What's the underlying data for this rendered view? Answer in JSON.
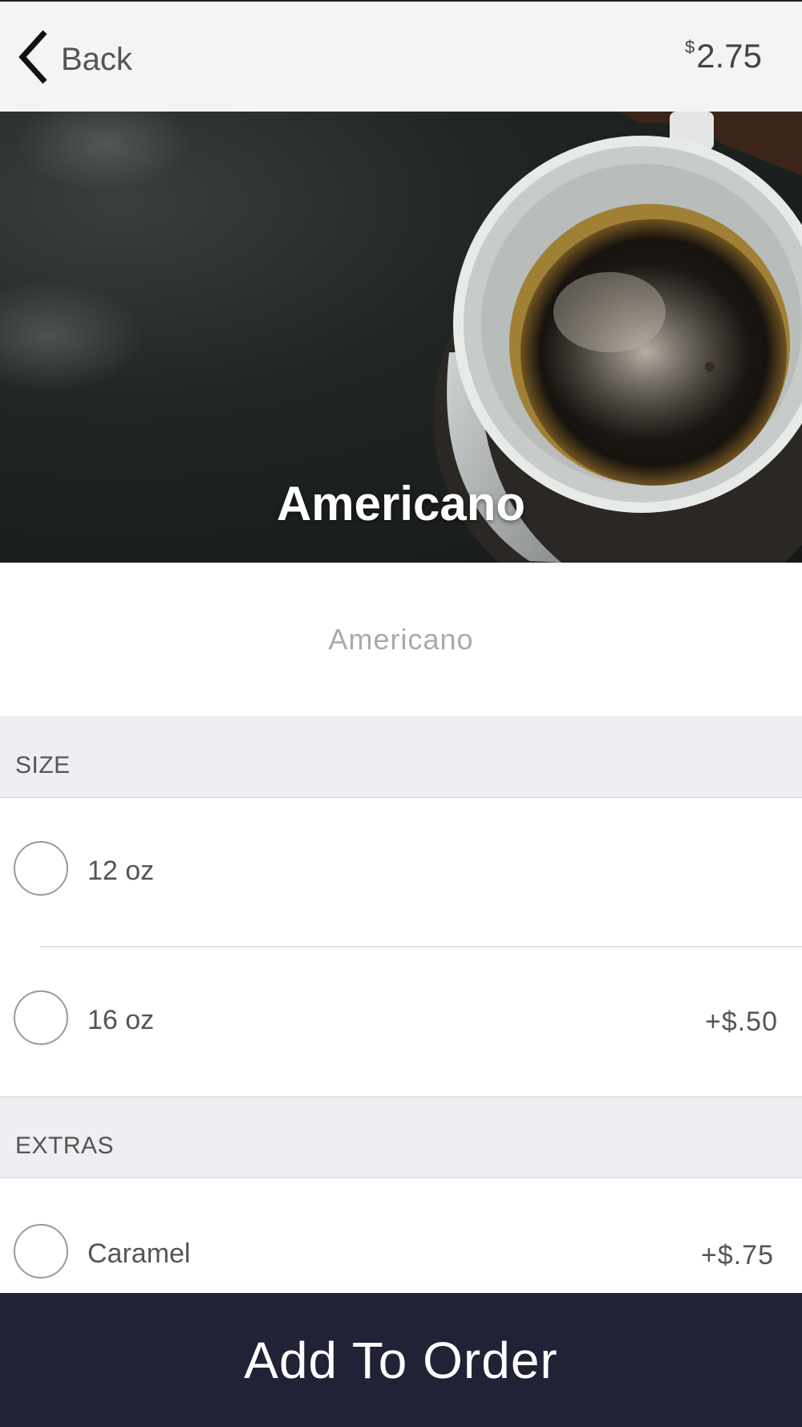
{
  "header": {
    "back_label": "Back",
    "price_symbol": "$",
    "price_value": "2.75"
  },
  "hero": {
    "title": "Americano"
  },
  "description": "Americano",
  "size_section": {
    "title": "SIZE",
    "options": [
      {
        "label": "12 oz",
        "price": ""
      },
      {
        "label": "16 oz",
        "price": "+$.50"
      }
    ]
  },
  "extras_section": {
    "title": "EXTRAS",
    "options": [
      {
        "label": "Caramel",
        "price": "+$.75"
      }
    ]
  },
  "add_button": "Add To Order",
  "colors": {
    "header_bg": "#f4f4f5",
    "section_bg": "#efeff3",
    "button_bg": "#222236"
  }
}
